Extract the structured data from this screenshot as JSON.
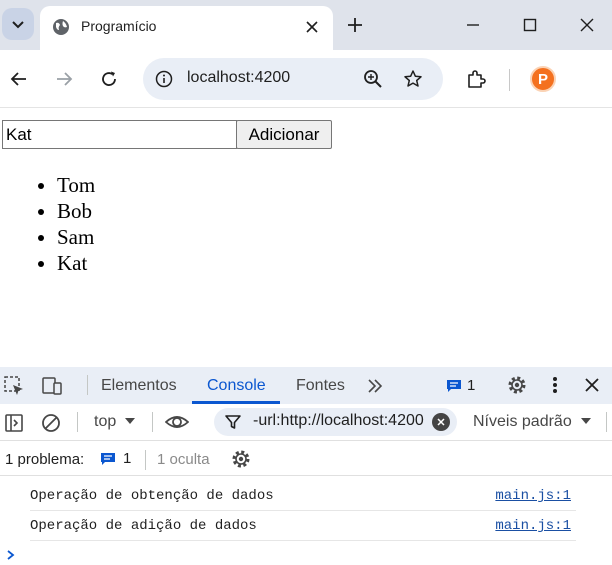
{
  "browser": {
    "tab": {
      "title": "Programício"
    },
    "address": {
      "url": "localhost:4200"
    },
    "profile": {
      "initial": "P"
    },
    "icons": [
      "tab-search-icon",
      "globe-icon",
      "close-icon",
      "plus-icon",
      "minimize-icon",
      "maximize-icon",
      "window-close-icon",
      "back-icon",
      "forward-icon",
      "reload-icon",
      "site-info-icon",
      "zoom-icon",
      "star-icon",
      "extensions-icon"
    ]
  },
  "page": {
    "input_value": "Kat",
    "add_button": "Adicionar",
    "names": [
      "Tom",
      "Bob",
      "Sam",
      "Kat"
    ]
  },
  "devtools": {
    "tabs": [
      "Elementos",
      "Console",
      "Fontes"
    ],
    "active_tab": "Console",
    "message_count": "1",
    "context": "top",
    "filter_text": "-url:http://localhost:4200",
    "levels": "Níveis padrão",
    "issues_label": "1 problema:",
    "issues_count": "1",
    "hidden_label": "1 oculta",
    "logs": [
      {
        "message": "Operação de obtenção de dados",
        "source": "main.js:1"
      },
      {
        "message": "Operação de adição de dados",
        "source": "main.js:1"
      }
    ],
    "colors": {
      "accent": "#0b57d0",
      "toolbar_bg": "#e9eef6",
      "link": "#1a4fa3"
    }
  }
}
